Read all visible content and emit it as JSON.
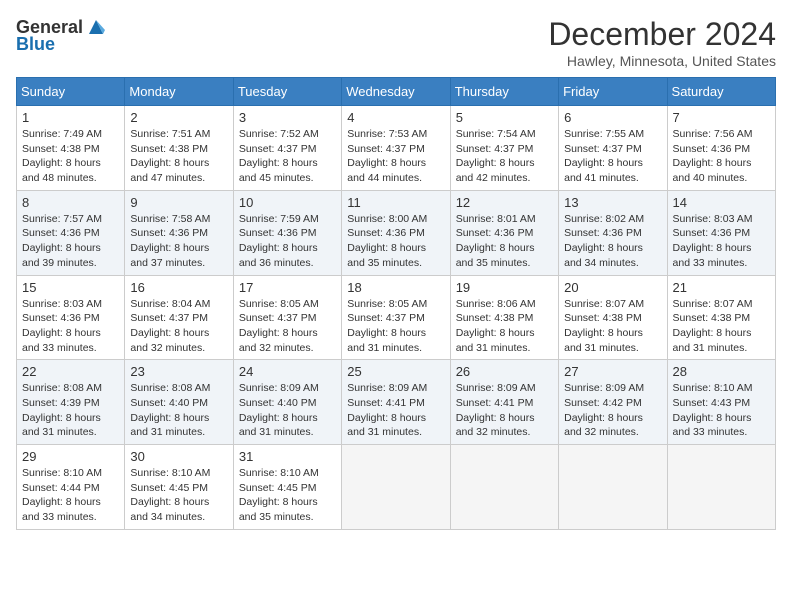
{
  "logo": {
    "line1": "General",
    "line2": "Blue"
  },
  "title": "December 2024",
  "location": "Hawley, Minnesota, United States",
  "days_of_week": [
    "Sunday",
    "Monday",
    "Tuesday",
    "Wednesday",
    "Thursday",
    "Friday",
    "Saturday"
  ],
  "weeks": [
    [
      {
        "day": "1",
        "sunrise": "7:49 AM",
        "sunset": "4:38 PM",
        "daylight": "8 hours and 48 minutes."
      },
      {
        "day": "2",
        "sunrise": "7:51 AM",
        "sunset": "4:38 PM",
        "daylight": "8 hours and 47 minutes."
      },
      {
        "day": "3",
        "sunrise": "7:52 AM",
        "sunset": "4:37 PM",
        "daylight": "8 hours and 45 minutes."
      },
      {
        "day": "4",
        "sunrise": "7:53 AM",
        "sunset": "4:37 PM",
        "daylight": "8 hours and 44 minutes."
      },
      {
        "day": "5",
        "sunrise": "7:54 AM",
        "sunset": "4:37 PM",
        "daylight": "8 hours and 42 minutes."
      },
      {
        "day": "6",
        "sunrise": "7:55 AM",
        "sunset": "4:37 PM",
        "daylight": "8 hours and 41 minutes."
      },
      {
        "day": "7",
        "sunrise": "7:56 AM",
        "sunset": "4:36 PM",
        "daylight": "8 hours and 40 minutes."
      }
    ],
    [
      {
        "day": "8",
        "sunrise": "7:57 AM",
        "sunset": "4:36 PM",
        "daylight": "8 hours and 39 minutes."
      },
      {
        "day": "9",
        "sunrise": "7:58 AM",
        "sunset": "4:36 PM",
        "daylight": "8 hours and 37 minutes."
      },
      {
        "day": "10",
        "sunrise": "7:59 AM",
        "sunset": "4:36 PM",
        "daylight": "8 hours and 36 minutes."
      },
      {
        "day": "11",
        "sunrise": "8:00 AM",
        "sunset": "4:36 PM",
        "daylight": "8 hours and 35 minutes."
      },
      {
        "day": "12",
        "sunrise": "8:01 AM",
        "sunset": "4:36 PM",
        "daylight": "8 hours and 35 minutes."
      },
      {
        "day": "13",
        "sunrise": "8:02 AM",
        "sunset": "4:36 PM",
        "daylight": "8 hours and 34 minutes."
      },
      {
        "day": "14",
        "sunrise": "8:03 AM",
        "sunset": "4:36 PM",
        "daylight": "8 hours and 33 minutes."
      }
    ],
    [
      {
        "day": "15",
        "sunrise": "8:03 AM",
        "sunset": "4:36 PM",
        "daylight": "8 hours and 33 minutes."
      },
      {
        "day": "16",
        "sunrise": "8:04 AM",
        "sunset": "4:37 PM",
        "daylight": "8 hours and 32 minutes."
      },
      {
        "day": "17",
        "sunrise": "8:05 AM",
        "sunset": "4:37 PM",
        "daylight": "8 hours and 32 minutes."
      },
      {
        "day": "18",
        "sunrise": "8:05 AM",
        "sunset": "4:37 PM",
        "daylight": "8 hours and 31 minutes."
      },
      {
        "day": "19",
        "sunrise": "8:06 AM",
        "sunset": "4:38 PM",
        "daylight": "8 hours and 31 minutes."
      },
      {
        "day": "20",
        "sunrise": "8:07 AM",
        "sunset": "4:38 PM",
        "daylight": "8 hours and 31 minutes."
      },
      {
        "day": "21",
        "sunrise": "8:07 AM",
        "sunset": "4:38 PM",
        "daylight": "8 hours and 31 minutes."
      }
    ],
    [
      {
        "day": "22",
        "sunrise": "8:08 AM",
        "sunset": "4:39 PM",
        "daylight": "8 hours and 31 minutes."
      },
      {
        "day": "23",
        "sunrise": "8:08 AM",
        "sunset": "4:40 PM",
        "daylight": "8 hours and 31 minutes."
      },
      {
        "day": "24",
        "sunrise": "8:09 AM",
        "sunset": "4:40 PM",
        "daylight": "8 hours and 31 minutes."
      },
      {
        "day": "25",
        "sunrise": "8:09 AM",
        "sunset": "4:41 PM",
        "daylight": "8 hours and 31 minutes."
      },
      {
        "day": "26",
        "sunrise": "8:09 AM",
        "sunset": "4:41 PM",
        "daylight": "8 hours and 32 minutes."
      },
      {
        "day": "27",
        "sunrise": "8:09 AM",
        "sunset": "4:42 PM",
        "daylight": "8 hours and 32 minutes."
      },
      {
        "day": "28",
        "sunrise": "8:10 AM",
        "sunset": "4:43 PM",
        "daylight": "8 hours and 33 minutes."
      }
    ],
    [
      {
        "day": "29",
        "sunrise": "8:10 AM",
        "sunset": "4:44 PM",
        "daylight": "8 hours and 33 minutes."
      },
      {
        "day": "30",
        "sunrise": "8:10 AM",
        "sunset": "4:45 PM",
        "daylight": "8 hours and 34 minutes."
      },
      {
        "day": "31",
        "sunrise": "8:10 AM",
        "sunset": "4:45 PM",
        "daylight": "8 hours and 35 minutes."
      },
      null,
      null,
      null,
      null
    ]
  ]
}
